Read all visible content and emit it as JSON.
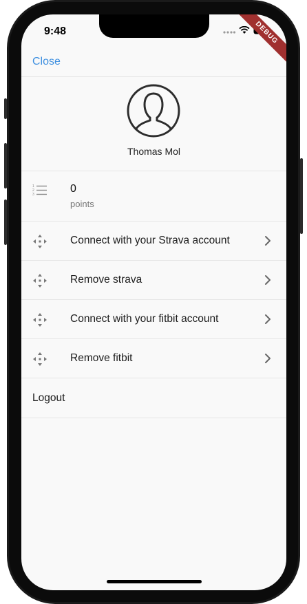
{
  "status_bar": {
    "time": "9:48",
    "debug_banner": "DEBUG"
  },
  "nav": {
    "close_label": "Close",
    "accent_color": "#3d8fe0"
  },
  "profile": {
    "avatar_icon": "person-outline-icon",
    "name": "Thomas Mol"
  },
  "points": {
    "icon": "numbered-list-icon",
    "value": "0",
    "label": "points"
  },
  "menu": {
    "items": [
      {
        "label": "Connect with your Strava account",
        "icon": "move-arrows-icon"
      },
      {
        "label": "Remove strava",
        "icon": "move-arrows-icon"
      },
      {
        "label": "Connect with your fitbit account",
        "icon": "move-arrows-icon"
      },
      {
        "label": "Remove fitbit",
        "icon": "move-arrows-icon"
      }
    ],
    "logout_label": "Logout"
  }
}
